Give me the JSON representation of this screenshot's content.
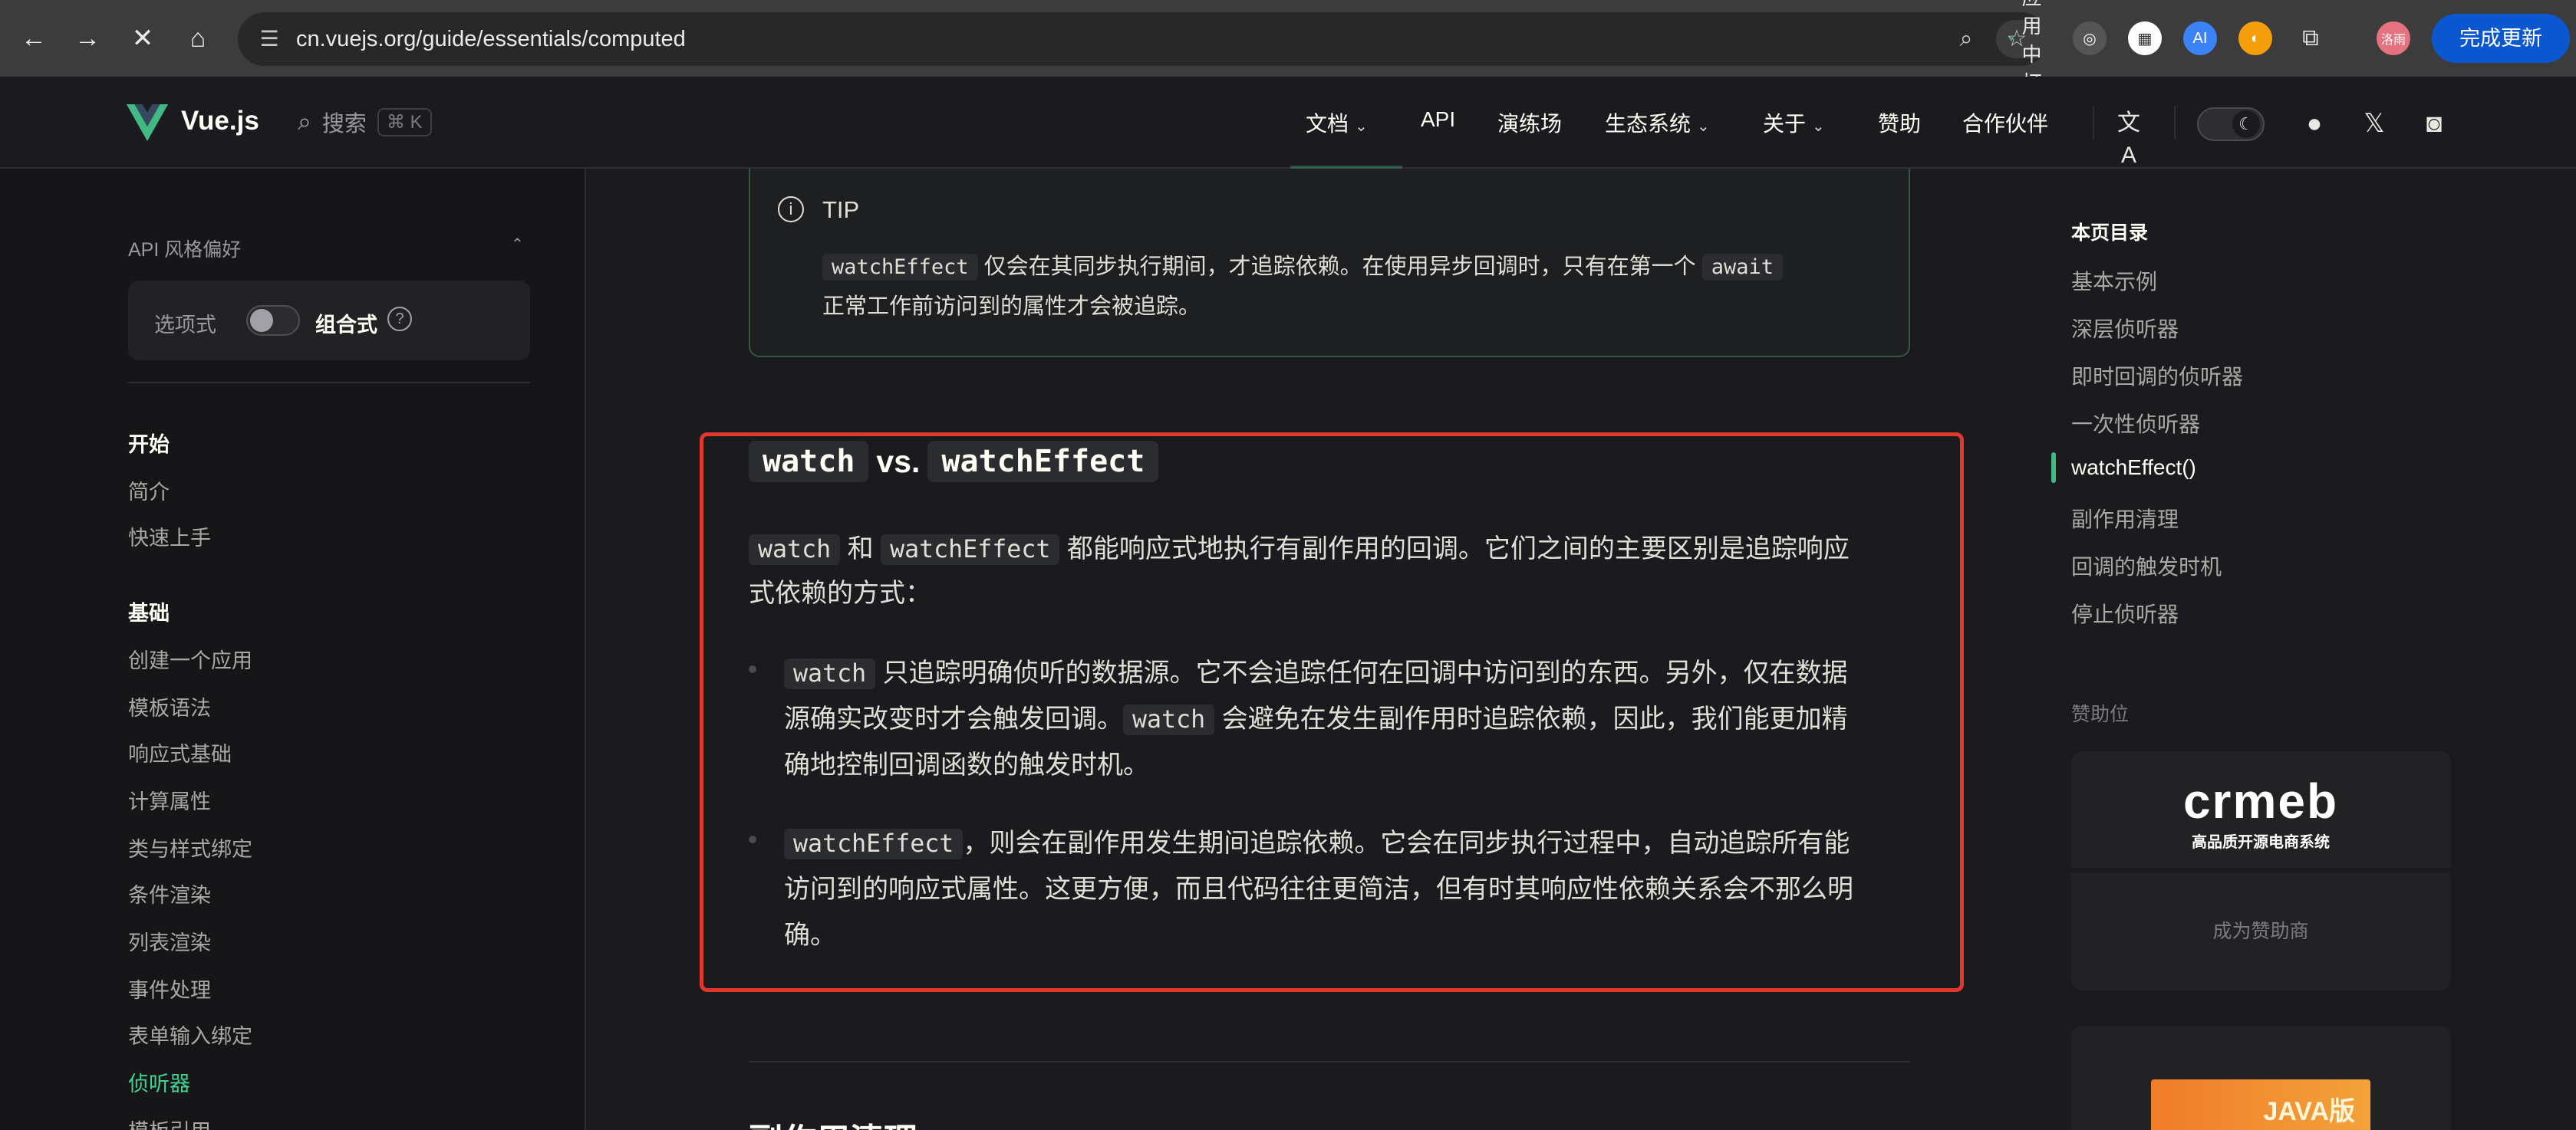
{
  "browser": {
    "url": "cn.vuejs.org/guide/essentials/computed",
    "open_in_app": "在应用中打开",
    "update_button": "完成更新",
    "profile_badge": "洛雨"
  },
  "nav": {
    "logo_text": "Vue.js",
    "search_label": "搜索",
    "search_shortcut": "⌘ K",
    "links": [
      "文档",
      "API",
      "演练场",
      "生态系统",
      "关于",
      "赞助",
      "合作伙伴"
    ]
  },
  "sidebar": {
    "pref_title": "API 风格偏好",
    "pref_options": "选项式",
    "pref_composition": "组合式",
    "pref_help": "?",
    "sections": [
      {
        "title": "开始",
        "items": [
          "简介",
          "快速上手"
        ]
      },
      {
        "title": "基础",
        "items": [
          "创建一个应用",
          "模板语法",
          "响应式基础",
          "计算属性",
          "类与样式绑定",
          "条件渲染",
          "列表渲染",
          "事件处理",
          "表单输入绑定",
          "侦听器",
          "模板引用"
        ]
      }
    ],
    "active_item": "侦听器"
  },
  "tip": {
    "title": "TIP",
    "code1": "watchEffect",
    "text1": "仅会在其同步执行期间，才追踪依赖。在使用异步回调时，只有在第一个",
    "code2": "await",
    "text2": "正常工作前访问到的属性才会被追踪。"
  },
  "section": {
    "h2_code1": "watch",
    "h2_vs": "vs.",
    "h2_code2": "watchEffect",
    "intro_code1": "watch",
    "intro_and": "和",
    "intro_code2": "watchEffect",
    "intro_text1": "都能响应式地执行有副作用的回调。它们之间的主要区别是追踪响应",
    "intro_text2": "式依赖的方式：",
    "b1_code": "watch",
    "b1_text1": "只追踪明确侦听的数据源。它不会追踪任何在回调中访问到的东西。另外，仅在数据",
    "b1_text2a": "源确实改变时才会触发回调。",
    "b1_code2": "watch",
    "b1_text2b": "会避免在发生副作用时追踪依赖，因此，我们能更加精",
    "b1_text3": "确地控制回调函数的触发时机。",
    "b2_code": "watchEffect",
    "b2_text1": "，则会在副作用发生期间追踪依赖。它会在同步执行过程中，自动追踪所有能",
    "b2_text2": "访问到的响应式属性。这更方便，而且代码往往更简洁，但有时其响应性依赖关系会不那么明",
    "b2_text3": "确。",
    "next_heading": "副作用清理"
  },
  "toc": {
    "title": "本页目录",
    "items": [
      "基本示例",
      "深层侦听器",
      "即时回调的侦听器",
      "一次性侦听器",
      "watchEffect()",
      "副作用清理",
      "回调的触发时机",
      "停止侦听器"
    ],
    "active": "watchEffect()"
  },
  "sponsor": {
    "title": "赞助位",
    "brand": "crmeb",
    "tagline": "高品质开源电商系统",
    "become": "成为赞助商",
    "ad_label": "JAVA版"
  },
  "colors": {
    "accent": "#42b883",
    "highlight_border": "#e0392b",
    "background": "#1b1b1f"
  }
}
